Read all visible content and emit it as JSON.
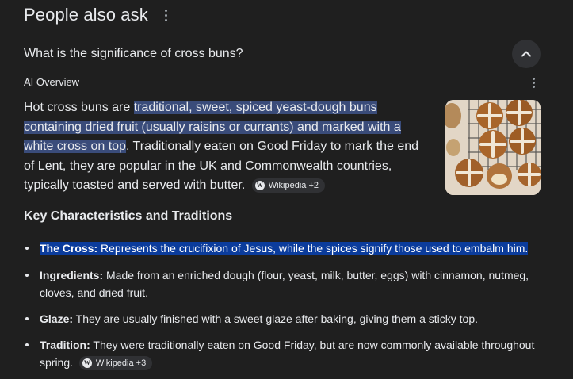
{
  "header": {
    "title": "People also ask"
  },
  "question": {
    "text": "What is the significance of cross buns?"
  },
  "ai_overview": {
    "label": "AI Overview",
    "para_lead": "Hot cross buns are ",
    "para_highlight": "traditional, sweet, spiced yeast-dough buns containing dried fruit (usually raisins or currants) and marked with a white cross on top",
    "para_rest": ". Traditionally eaten on Good Friday to mark the end of Lent, they are popular in the UK and Commonwealth countries, typically toasted and served with butter.",
    "source_chip": "Wikipedia +2"
  },
  "section": {
    "title": "Key Characteristics and Traditions"
  },
  "bullets": [
    {
      "label": "The Cross:",
      "text": " Represents the crucifixion of Jesus, while the spices signify those used to embalm him."
    },
    {
      "label": "Ingredients:",
      "text": " Made from an enriched dough (flour, yeast, milk, butter, eggs) with cinnamon, nutmeg, cloves, and dried fruit."
    },
    {
      "label": "Glaze:",
      "text": " They are usually finished with a sweet glaze after baking, giving them a sticky top."
    },
    {
      "label": "Tradition:",
      "text": " They were traditionally eaten on Good Friday, but are now commonly available throughout spring.",
      "chip": "Wikipedia +3"
    }
  ],
  "icons": {
    "wiki": "wikipedia-icon",
    "collapse": "chevron-up-icon",
    "menu": "more-vert-icon"
  },
  "colors": {
    "background": "#1f1f1f",
    "text": "#e8eaed",
    "highlight": "#3a4c7a",
    "selection": "#0b3c9c"
  }
}
